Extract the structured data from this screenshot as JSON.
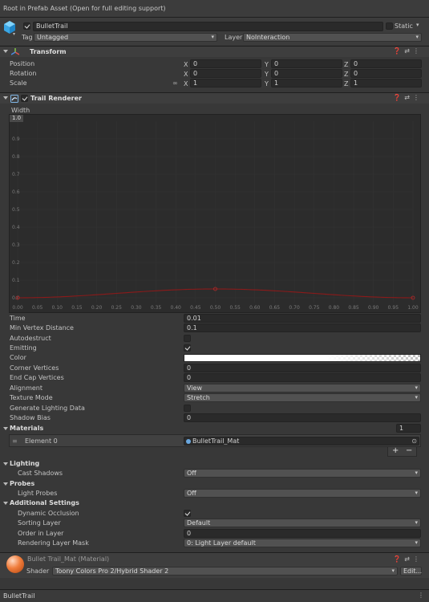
{
  "top_bar": {
    "text": "Root in Prefab Asset (Open for full editing support)"
  },
  "object": {
    "name": "BulletTrail",
    "active": true,
    "static_label": "Static",
    "tag_label": "Tag",
    "tag_value": "Untagged",
    "layer_label": "Layer",
    "layer_value": "NoInteraction"
  },
  "transform": {
    "title": "Transform",
    "rows": [
      {
        "label": "Position",
        "x": "0",
        "y": "0",
        "z": "0"
      },
      {
        "label": "Rotation",
        "x": "0",
        "y": "0",
        "z": "0"
      },
      {
        "label": "Scale",
        "x": "1",
        "y": "1",
        "z": "1"
      }
    ],
    "axis": {
      "x": "X",
      "y": "Y",
      "z": "Z"
    }
  },
  "trail": {
    "title": "Trail Renderer",
    "width_label": "Width",
    "width_value": "1.0",
    "curve_color": "#8b1a1a"
  },
  "chart_data": {
    "type": "line",
    "title": "Width",
    "xlim": [
      0,
      1.0
    ],
    "ylim": [
      0,
      1.0
    ],
    "x_ticks": [
      "0.00",
      "0.05",
      "0.10",
      "0.15",
      "0.20",
      "0.25",
      "0.30",
      "0.35",
      "0.40",
      "0.45",
      "0.50",
      "0.55",
      "0.60",
      "0.65",
      "0.70",
      "0.75",
      "0.80",
      "0.85",
      "0.90",
      "0.95",
      "1.00"
    ],
    "y_ticks": [
      "0.9",
      "0.8",
      "0.7",
      "0.6",
      "0.5",
      "0.4",
      "0.3",
      "0.2",
      "0.1",
      "0.0"
    ],
    "keys": [
      {
        "x": 0.0,
        "y": 0.0
      },
      {
        "x": 0.5,
        "y": 0.05
      },
      {
        "x": 1.0,
        "y": 0.0
      }
    ]
  },
  "props": {
    "time_label": "Time",
    "time_value": "0.01",
    "min_vertex_label": "Min Vertex Distance",
    "min_vertex_value": "0.1",
    "autodestruct_label": "Autodestruct",
    "emitting_label": "Emitting",
    "color_label": "Color",
    "corner_label": "Corner Vertices",
    "corner_value": "0",
    "endcap_label": "End Cap Vertices",
    "endcap_value": "0",
    "alignment_label": "Alignment",
    "alignment_value": "View",
    "texture_label": "Texture Mode",
    "texture_value": "Stretch",
    "genlight_label": "Generate Lighting Data",
    "shadowbias_label": "Shadow Bias",
    "shadowbias_value": "0"
  },
  "materials": {
    "title": "Materials",
    "count": "1",
    "element_label": "Element 0",
    "element_value": "BulletTrail_Mat",
    "add": "+",
    "remove": "−"
  },
  "lighting": {
    "title": "Lighting",
    "cast_label": "Cast Shadows",
    "cast_value": "Off"
  },
  "probes": {
    "title": "Probes",
    "light_label": "Light Probes",
    "light_value": "Off"
  },
  "additional": {
    "title": "Additional Settings",
    "occlusion_label": "Dynamic Occlusion",
    "sorting_label": "Sorting Layer",
    "sorting_value": "Default",
    "order_label": "Order in Layer",
    "order_value": "0",
    "mask_label": "Rendering Layer Mask",
    "mask_value": "0: Light Layer default"
  },
  "material_panel": {
    "title": "Bullet Trail_Mat (Material)",
    "shader_label": "Shader",
    "shader_value": "Toony Colors Pro 2/Hybrid Shader 2",
    "edit_label": "Edit..."
  },
  "bottom_bar": {
    "text": "BulletTrail"
  }
}
